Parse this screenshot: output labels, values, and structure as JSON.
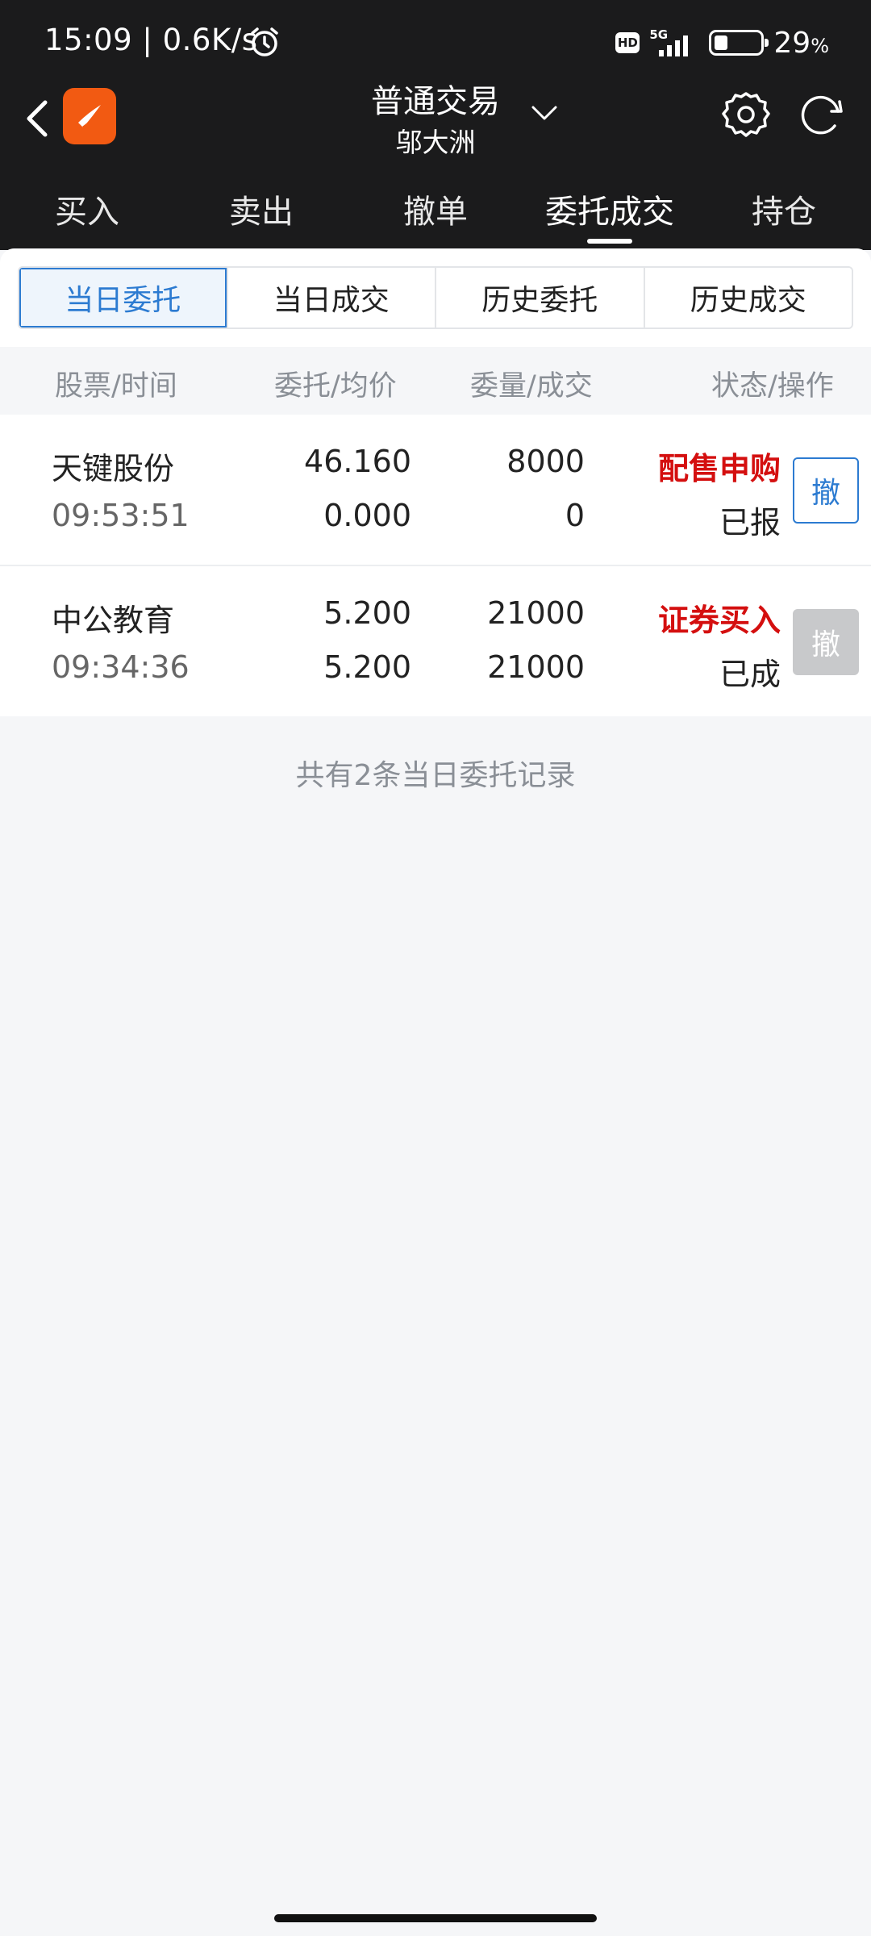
{
  "status_bar": {
    "time_speed": "15:09 | 0.6K/s",
    "hd": "HD",
    "network": "5G",
    "battery_percent": 29,
    "battery_text": "29",
    "battery_unit": "%"
  },
  "header": {
    "title": "普通交易",
    "subtitle": "邬大洲",
    "icons": [
      "back-arrow-icon",
      "app-logo-icon",
      "chevron-down-icon",
      "gear-icon",
      "refresh-icon"
    ],
    "logo_color": "#f25a12"
  },
  "main_tabs": [
    {
      "label": "买入"
    },
    {
      "label": "卖出"
    },
    {
      "label": "撤单"
    },
    {
      "label": "委托成交",
      "active": true
    },
    {
      "label": "持仓"
    }
  ],
  "sub_tabs": [
    {
      "label": "当日委托",
      "active": true
    },
    {
      "label": "当日成交"
    },
    {
      "label": "历史委托"
    },
    {
      "label": "历史成交"
    }
  ],
  "columns": [
    "股票/时间",
    "委托/均价",
    "委量/成交",
    "状态/操作"
  ],
  "orders": [
    {
      "name": "天键股份",
      "time": "09:53:51",
      "price": "46.160",
      "avg_price": "0.000",
      "qty": "8000",
      "filled": "0",
      "type": "配售申购",
      "state": "已报",
      "cancel_label": "撤",
      "cancel_enabled": true
    },
    {
      "name": "中公教育",
      "time": "09:34:36",
      "price": "5.200",
      "avg_price": "5.200",
      "qty": "21000",
      "filled": "21000",
      "type": "证券买入",
      "state": "已成",
      "cancel_label": "撤",
      "cancel_enabled": false
    }
  ],
  "summary": "共有2条当日委托记录",
  "colors": {
    "topbar": "#1b1b1c",
    "accent_blue": "#2c7bd1",
    "red": "#d40f0f",
    "muted": "#8a8f96"
  }
}
